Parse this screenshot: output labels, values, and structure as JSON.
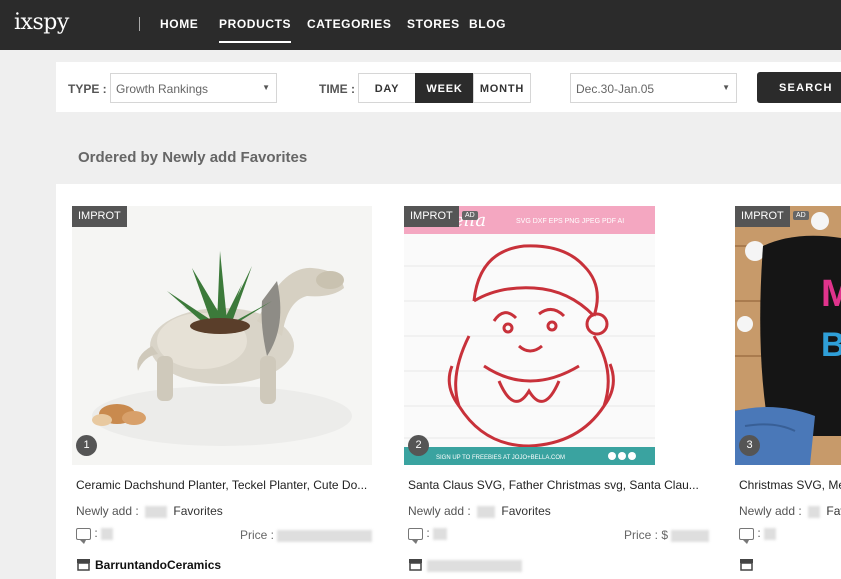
{
  "logo": "ixspy",
  "nav": {
    "home": "HOME",
    "products": "PRODUCTS",
    "categories": "CATEGORIES",
    "stores": "STORES",
    "blog": "BLOG"
  },
  "filters": {
    "type_label": "TYPE :",
    "type_value": "Growth Rankings",
    "time_label": "TIME :",
    "time_options": [
      "DAY",
      "WEEK",
      "MONTH"
    ],
    "time_selected": "WEEK",
    "date_range": "Dec.30-Jan.05",
    "search_label": "SEARCH"
  },
  "section_title": "Ordered by Newly add Favorites",
  "products": [
    {
      "badge": "IMPROT",
      "rank": "1",
      "title": "Ceramic Dachshund Planter, Teckel Planter, Cute Do...",
      "newly_label": "Newly add :",
      "favorites_label": "Favorites",
      "comments_label": ":",
      "price_label": "Price :",
      "store": "BarruntandoCeramics"
    },
    {
      "badge": "IMPROT",
      "ad": "AD",
      "rank": "2",
      "title": "Santa Claus SVG, Father Christmas svg, Santa Clau...",
      "newly_label": "Newly add :",
      "favorites_label": "Favorites",
      "comments_label": ":",
      "price_label": "Price : $",
      "banner_text": "SVG DXF EPS PNG JPEG PDF AI",
      "footer_text": "SIGN UP TO FREEBIES AT JOJO+BELLA.COM",
      "brand_text": "Bella"
    },
    {
      "badge": "IMPROT",
      "ad": "AD",
      "rank": "3",
      "title": "Christmas SVG, Me...",
      "newly_label": "Newly add :",
      "favorites_label": "Fav",
      "comments_label": ":"
    }
  ],
  "colors": {
    "topbar": "#2b2b2b",
    "page_bg": "#efefef",
    "santa_red": "#c8313a",
    "banner_pink": "#f4a7c1",
    "footer_teal": "#3aa3a0"
  }
}
